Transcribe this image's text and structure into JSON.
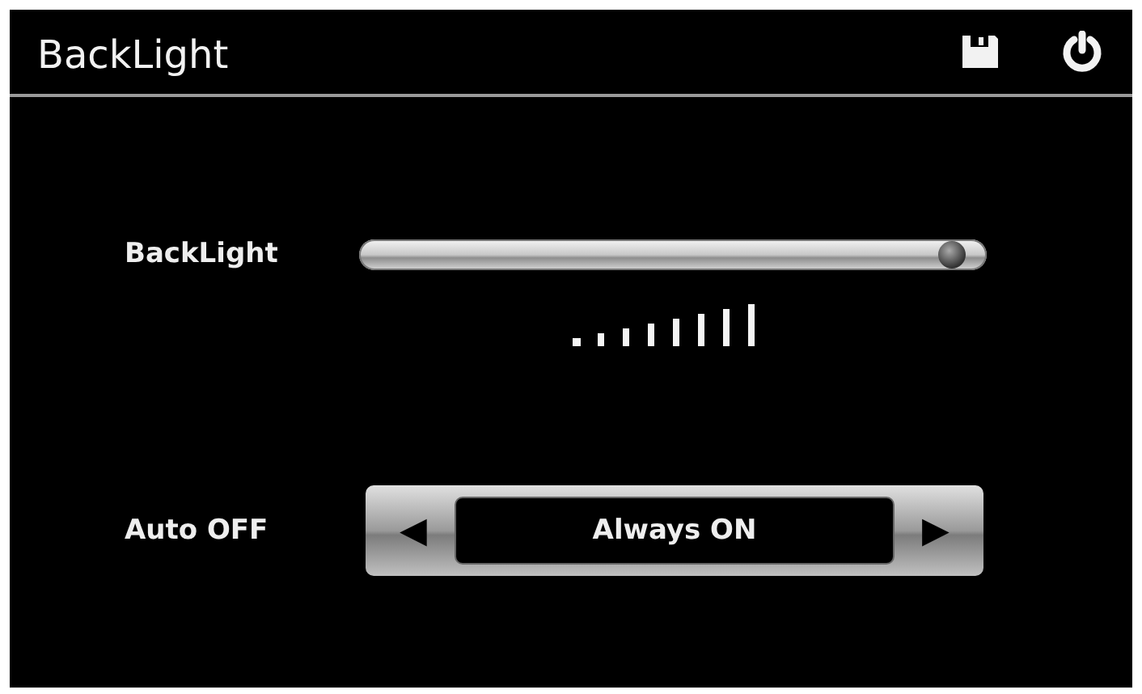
{
  "header": {
    "title": "BackLight"
  },
  "backlight": {
    "label": "BackLight",
    "level": 0.97
  },
  "auto_off": {
    "label": "Auto OFF",
    "value": "Always ON",
    "prev": "◀",
    "next": "▶"
  }
}
